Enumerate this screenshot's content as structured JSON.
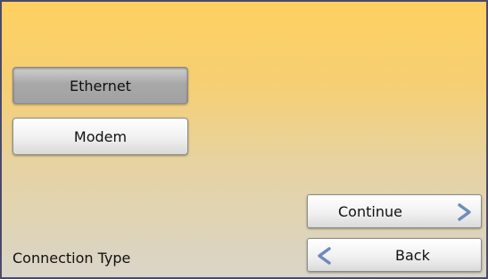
{
  "options": [
    {
      "label": "Ethernet",
      "selected": true
    },
    {
      "label": "Modem",
      "selected": false
    }
  ],
  "nav": {
    "continue_label": "Continue",
    "back_label": "Back"
  },
  "footer": {
    "label": "Connection Type"
  },
  "icons": {
    "continue": "chevron-right-icon",
    "back": "chevron-left-icon"
  },
  "colors": {
    "arrow": "#6f8bbd",
    "selected_button": "#a8a8a8",
    "background_top": "#ffd060",
    "background_bottom": "#d9d5c8"
  }
}
